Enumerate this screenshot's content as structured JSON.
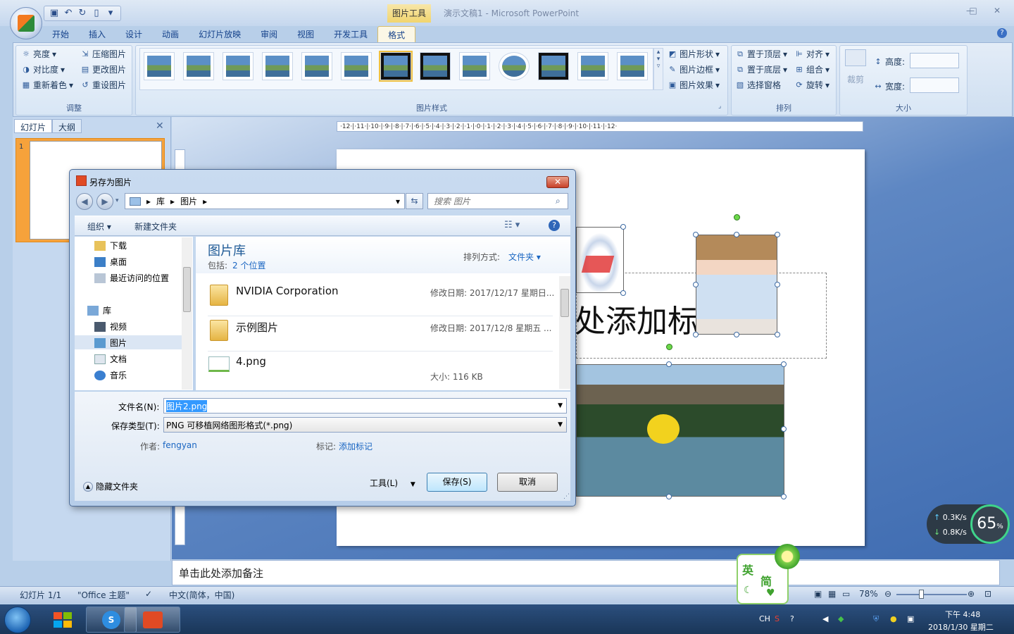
{
  "app": {
    "doc_title": "演示文稿1 - Microsoft PowerPoint",
    "tools_tab": "图片工具"
  },
  "tabs": [
    "开始",
    "插入",
    "设计",
    "动画",
    "幻灯片放映",
    "审阅",
    "视图",
    "开发工具",
    "格式"
  ],
  "ribbon": {
    "adjust": {
      "label": "调整",
      "brightness": "亮度",
      "contrast": "对比度",
      "recolor": "重新着色",
      "compress": "压缩图片",
      "change": "更改图片",
      "reset": "重设图片"
    },
    "styles": {
      "label": "图片样式",
      "shape": "图片形状",
      "border": "图片边框",
      "effects": "图片效果"
    },
    "arrange": {
      "label": "排列",
      "front": "置于顶层",
      "back": "置于底层",
      "pane": "选择窗格",
      "align": "对齐",
      "group": "组合",
      "rotate": "旋转"
    },
    "size": {
      "label": "大小",
      "crop": "裁剪",
      "height": "高度:",
      "width": "宽度:"
    }
  },
  "left_pane": {
    "tab_slides": "幻灯片",
    "tab_outline": "大纲",
    "slide_number": "1"
  },
  "ruler": "·12·|·11·|·10·|·9·|·8·|·7·|·6·|·5·|·4·|·3·|·2·|·1·|·0·|·1·|·2·|·3·|·4·|·5·|·6·|·7·|·8·|·9·|·10·|·11·|·12·",
  "slide": {
    "title_text": "处添加标"
  },
  "notes": "单击此处添加备注",
  "statusbar": {
    "slide": "幻灯片 1/1",
    "theme": "\"Office 主题\"",
    "language": "中文(简体，中国)",
    "zoom": "78%"
  },
  "dialog": {
    "title": "另存为图片",
    "breadcrumb": [
      "库",
      "图片"
    ],
    "search_placeholder": "搜索 图片",
    "organize": "组织",
    "new_folder": "新建文件夹",
    "nav": {
      "downloads": "下载",
      "desktop": "桌面",
      "recent": "最近访问的位置",
      "libraries": "库",
      "videos": "视频",
      "pictures": "图片",
      "documents": "文档",
      "music": "音乐"
    },
    "library_title": "图片库",
    "includes_label": "包括:",
    "includes_value": "2 个位置",
    "sort_label": "排列方式:",
    "sort_value": "文件夹",
    "files": [
      {
        "name": "NVIDIA Corporation",
        "meta": "修改日期: 2017/12/17 星期日..."
      },
      {
        "name": "示例图片",
        "meta": "修改日期: 2017/12/8 星期五 ..."
      },
      {
        "name": "4.png",
        "meta": "大小: 116 KB"
      }
    ],
    "filename_label": "文件名(N):",
    "filename_value": "图片2.png",
    "filetype_label": "保存类型(T):",
    "filetype_value": "PNG 可移植网络图形格式(*.png)",
    "author_label": "作者:",
    "author_value": "fengyan",
    "tags_label": "标记:",
    "tags_value": "添加标记",
    "hide_folders": "隐藏文件夹",
    "tools": "工具(L)",
    "save": "保存(S)",
    "cancel": "取消"
  },
  "overlay": {
    "upload": "0.3K/s",
    "download": "0.8K/s",
    "percent": "65",
    "percent_unit": "%",
    "ime_1": "英",
    "ime_2": "简"
  },
  "taskbar": {
    "time": "下午 4:48",
    "date": "2018/1/30 星期二",
    "lang": "CH"
  }
}
